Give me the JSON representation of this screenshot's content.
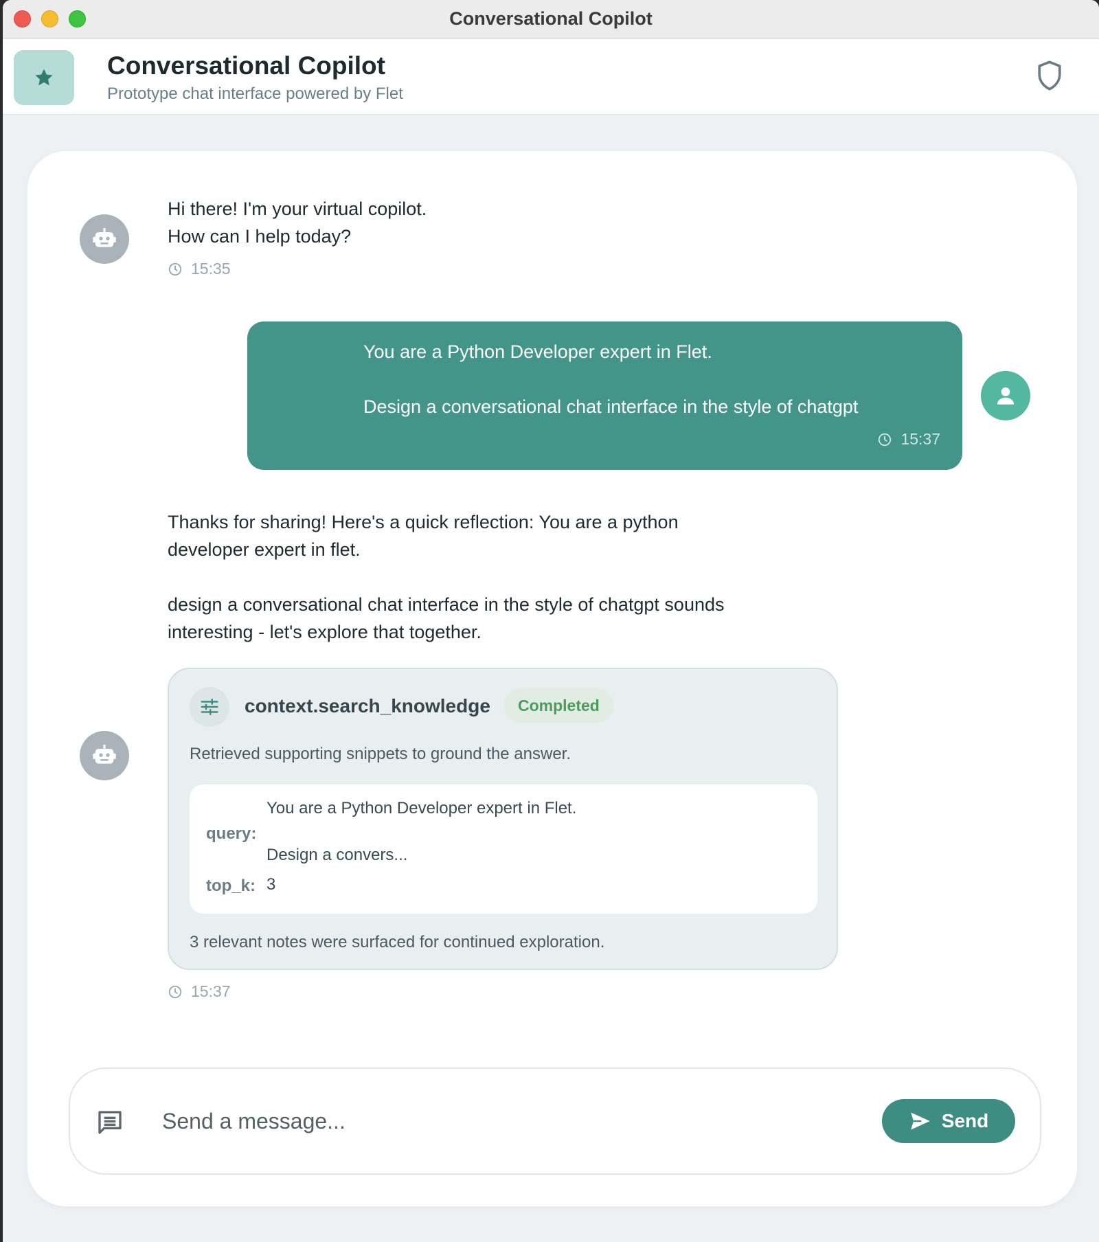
{
  "window": {
    "title": "Conversational Copilot"
  },
  "header": {
    "title": "Conversational Copilot",
    "subtitle": "Prototype chat interface powered by Flet",
    "logo_icon": "star-icon",
    "right_icon": "shield-icon"
  },
  "messages": [
    {
      "role": "assistant",
      "text": "Hi there! I'm your virtual copilot.\nHow can I help today?",
      "time": "15:35"
    },
    {
      "role": "user",
      "text": "You are a Python Developer expert in Flet.\n\nDesign a conversational chat interface in the style of chatgpt",
      "time": "15:37"
    },
    {
      "role": "assistant",
      "text": "Thanks for sharing! Here's a quick reflection: You are a python\ndeveloper expert in flet.\n\ndesign a conversational chat interface in the style of chatgpt sounds\ninteresting - let's explore that together.",
      "time": "15:37",
      "tool": {
        "name": "context.search_knowledge",
        "status": "Completed",
        "description": "Retrieved supporting snippets to ground the answer.",
        "args": {
          "query_key": "query:",
          "query_value": "You are a Python Developer expert in Flet.\n\nDesign a convers...",
          "top_k_key": "top_k:",
          "top_k_value": "3"
        },
        "footer": "3 relevant notes were surfaced for continued exploration."
      }
    }
  ],
  "composer": {
    "placeholder": "Send a message...",
    "send_label": "Send"
  },
  "colors": {
    "accent": "#43958a",
    "user_avatar": "#54b7a0",
    "bot_avatar": "#a9b3b9",
    "status_completed": "#4c9b5c"
  }
}
